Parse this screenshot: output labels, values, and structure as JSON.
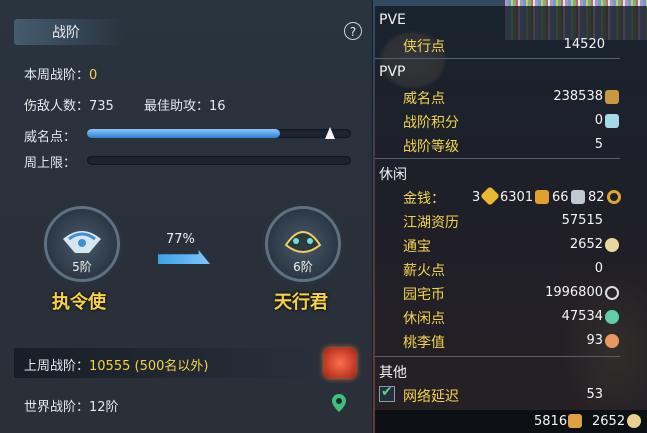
{
  "left_panel": {
    "title": "战阶",
    "help": "?",
    "week_rank_label": "本周战阶：",
    "week_rank_value": "0",
    "kills_label": "伤敌人数：",
    "kills_value": "735",
    "assists_label": "最佳助攻：",
    "assists_value": "16",
    "fame_label": "威名点：",
    "fame_fill": 0.73,
    "cap_label": "周上限：",
    "cap_fill": 0.0,
    "current_emblem": {
      "level": "5阶",
      "name": "执令使"
    },
    "next_emblem": {
      "level": "6阶",
      "name": "天行君"
    },
    "progress": "77%",
    "last_week_label": "上周战阶：",
    "last_week_value": "10555 (500名以外)",
    "world_label": "世界战阶：",
    "world_value": "12阶"
  },
  "right_panel": {
    "pve": {
      "section": "PVE",
      "items": [
        {
          "label": "侠行点",
          "value": "14520"
        }
      ]
    },
    "pvp": {
      "section": "PVP",
      "items": [
        {
          "label": "威名点",
          "value": "238538"
        },
        {
          "label": "战阶积分",
          "value": "0"
        },
        {
          "label": "战阶等级",
          "value": "5"
        }
      ]
    },
    "leisure": {
      "section": "休闲",
      "money_label": "金钱：",
      "money_values": [
        "3",
        "6301",
        "66",
        "82"
      ],
      "items": [
        {
          "label": "江湖资历",
          "value": "57515"
        },
        {
          "label": "通宝",
          "value": "2652"
        },
        {
          "label": "薪火点",
          "value": "0"
        },
        {
          "label": "园宅币",
          "value": "1996800"
        },
        {
          "label": "休闲点",
          "value": "47534"
        },
        {
          "label": "桃李值",
          "value": "93"
        }
      ]
    },
    "other": {
      "section": "其他",
      "items": [
        {
          "label": "网络延迟",
          "value": "53"
        }
      ]
    },
    "footer": {
      "left_value": "5816",
      "right_value": "2652"
    }
  },
  "colors": {
    "accent_yellow": "#f2d44c",
    "bar_blue": "#2f7fd0"
  }
}
